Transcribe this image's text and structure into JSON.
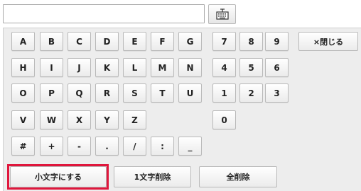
{
  "input": {
    "value": "",
    "placeholder": ""
  },
  "toggle": {
    "icon": "keyboard-icon"
  },
  "close": {
    "label": "×閉じる"
  },
  "keys": {
    "A": "A",
    "B": "B",
    "C": "C",
    "D": "D",
    "E": "E",
    "F": "F",
    "G": "G",
    "H": "H",
    "I": "I",
    "J": "J",
    "K": "K",
    "L": "L",
    "M": "M",
    "N": "N",
    "O": "O",
    "P": "P",
    "Q": "Q",
    "R": "R",
    "S": "S",
    "T": "T",
    "U": "U",
    "V": "V",
    "W": "W",
    "X": "X",
    "Y": "Y",
    "Z": "Z",
    "n7": "7",
    "n8": "8",
    "n9": "9",
    "n4": "4",
    "n5": "5",
    "n6": "6",
    "n1": "1",
    "n2": "2",
    "n3": "3",
    "n0": "0",
    "hash": "#",
    "plus": "+",
    "minus": "-",
    "dot": ".",
    "slash": "/",
    "colon": ":",
    "underscore": "_"
  },
  "actions": {
    "lowercase": "小文字にする",
    "delete_one": "1文字削除",
    "delete_all": "全削除"
  },
  "highlight": {
    "color": "#e0163c"
  }
}
